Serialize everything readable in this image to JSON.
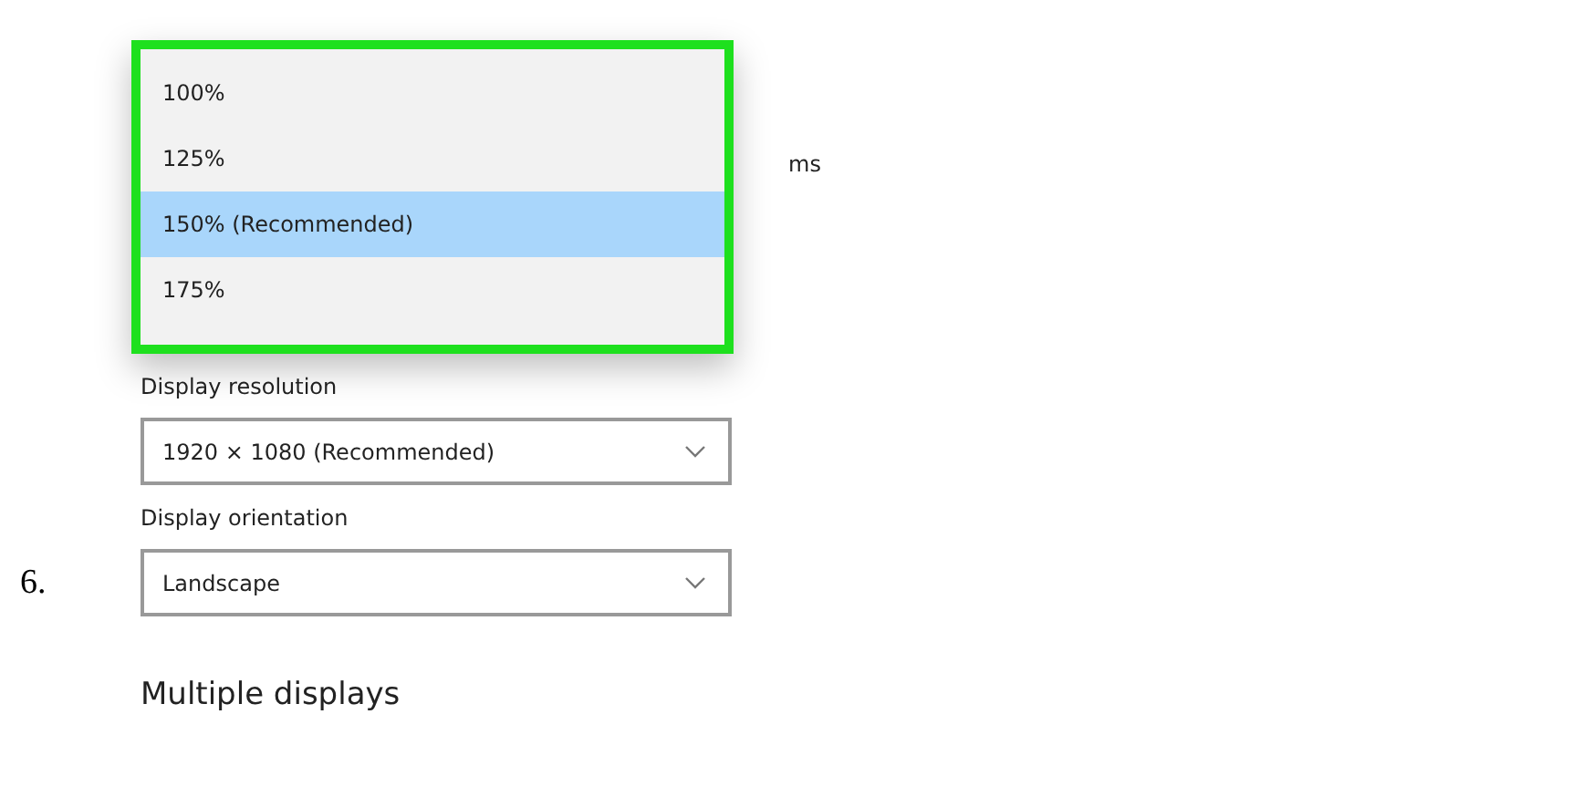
{
  "scale_menu": {
    "options": [
      {
        "label": "100%",
        "selected": false
      },
      {
        "label": "125%",
        "selected": false
      },
      {
        "label": "150% (Recommended)",
        "selected": true
      },
      {
        "label": "175%",
        "selected": false
      }
    ]
  },
  "covered_text": "ms",
  "fields": [
    {
      "label": "Display resolution",
      "value": "1920 × 1080 (Recommended)"
    },
    {
      "label": "Display orientation",
      "value": "Landscape"
    }
  ],
  "step_number": "6.",
  "section_heading": "Multiple displays"
}
